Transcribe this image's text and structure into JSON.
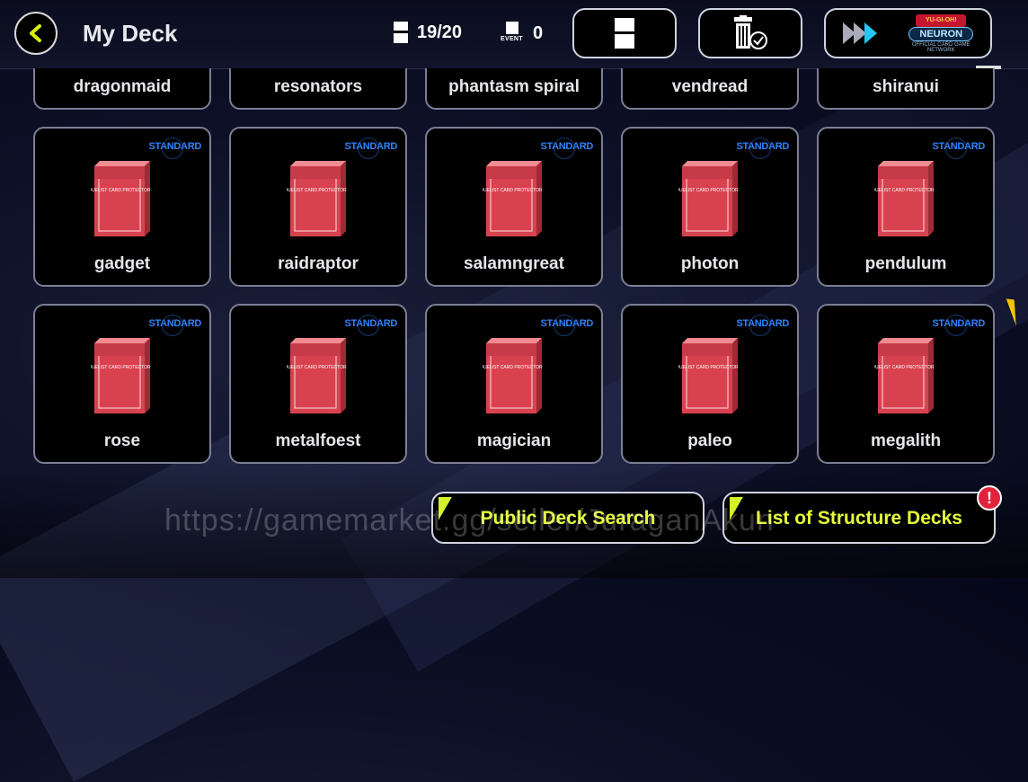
{
  "header": {
    "title": "My Deck",
    "deck_count": "19/20",
    "event_count": "0",
    "event_icon_label": "EVENT",
    "neuron_logo_top": "YU-GI-OH!",
    "neuron_logo_text": "NEURON",
    "neuron_logo_sub": "OFFICIAL CARD GAME NETWORK",
    "icons": {
      "back": "chevron-left-icon",
      "deck_count": "deck-icon",
      "event": "event-deck-icon",
      "new_deck": "new-deck-icon",
      "trash": "trash-check-icon",
      "neuron": "neuron-link-icon"
    }
  },
  "decks_top_row": [
    {
      "name": "dragonmaid"
    },
    {
      "name": "resonators"
    },
    {
      "name": "phantasm spiral"
    },
    {
      "name": "vendread"
    },
    {
      "name": "shiranui"
    }
  ],
  "decks": [
    {
      "name": "gadget",
      "badge": "STANDARD"
    },
    {
      "name": "raidraptor",
      "badge": "STANDARD"
    },
    {
      "name": "salamngreat",
      "badge": "STANDARD"
    },
    {
      "name": "photon",
      "badge": "STANDARD"
    },
    {
      "name": "pendulum",
      "badge": "STANDARD"
    },
    {
      "name": "rose",
      "badge": "STANDARD"
    },
    {
      "name": "metalfoest",
      "badge": "STANDARD"
    },
    {
      "name": "magician",
      "badge": "STANDARD"
    },
    {
      "name": "paleo",
      "badge": "STANDARD"
    },
    {
      "name": "megalith",
      "badge": "STANDARD"
    }
  ],
  "deck_box_label": "DUELIST CARD PROTECTOR",
  "buttons": {
    "public_deck_search": "Public Deck Search",
    "structure_decks": "List of Structure Decks",
    "alert": "!"
  },
  "watermark": "https://gamemarket.gg/seller/JuraganAkun",
  "colors": {
    "accent_yellow": "#e5ff3a",
    "badge_blue": "#2f83ff",
    "deck_box_red": "#d8424f",
    "alert_red": "#e2213b"
  }
}
